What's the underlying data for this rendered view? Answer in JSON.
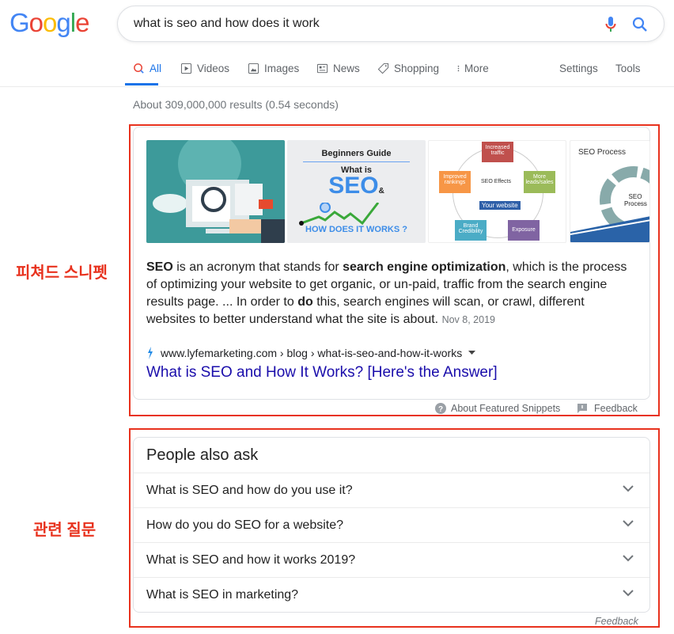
{
  "logo": {
    "letters": [
      "G",
      "o",
      "o",
      "g",
      "l",
      "e"
    ],
    "colors": [
      "#4285f4",
      "#ea4335",
      "#fbbc05",
      "#4285f4",
      "#34a853",
      "#ea4335"
    ]
  },
  "search": {
    "query": "what is seo and how does it work",
    "mic_icon": "mic-icon",
    "search_icon": "search-icon"
  },
  "tabs": [
    {
      "label": "All",
      "icon": "search-icon",
      "active": true
    },
    {
      "label": "Videos",
      "icon": "play-icon"
    },
    {
      "label": "Images",
      "icon": "image-icon"
    },
    {
      "label": "News",
      "icon": "news-icon"
    },
    {
      "label": "Shopping",
      "icon": "tag-icon"
    },
    {
      "label": "More",
      "icon": "more-vert-icon"
    }
  ],
  "tools": {
    "settings": "Settings",
    "tools": "Tools"
  },
  "result_count": "About 309,000,000 results (0.54 seconds)",
  "featured": {
    "images": [
      {
        "kind": "illustration"
      },
      {
        "heading": "Beginners Guide",
        "what": "What is",
        "seo": "SEO",
        "amp": "&",
        "how": "HOW DOES IT WORKS ?"
      },
      {
        "center": "SEO Effects",
        "site": "Your website",
        "nodes": [
          "Increased traffic",
          "More leads/sales",
          "Exposure",
          "Brand Credibility",
          "Improved rankings"
        ]
      },
      {
        "heading": "SEO Process",
        "center": "SEO Process"
      }
    ],
    "snippet": [
      {
        "t": "SEO",
        "b": true
      },
      {
        "t": " is an acronym that stands for "
      },
      {
        "t": "search engine optimization",
        "b": true
      },
      {
        "t": ", which is the process of optimizing your website to get organic, or un-paid, traffic from the search engine results page. ... In order to "
      },
      {
        "t": "do",
        "b": true
      },
      {
        "t": " this, search engines will scan, or crawl, different websites to better understand what the site is about. "
      }
    ],
    "date": "Nov 8, 2019",
    "url": "www.lyfemarketing.com › blog › what-is-seo-and-how-it-works",
    "title": "What is SEO and How It Works? [Here's the Answer]",
    "about": "About Featured Snippets",
    "feedback": "Feedback"
  },
  "annotations": {
    "featured": "피쳐드 스니펫",
    "related": "관련 질문",
    "color": "#e8321e"
  },
  "paa": {
    "heading": "People also ask",
    "questions": [
      "What is SEO and how do you use it?",
      "How do you do SEO for a website?",
      "What is SEO and how it works 2019?",
      "What is SEO in marketing?"
    ],
    "feedback": "Feedback"
  }
}
